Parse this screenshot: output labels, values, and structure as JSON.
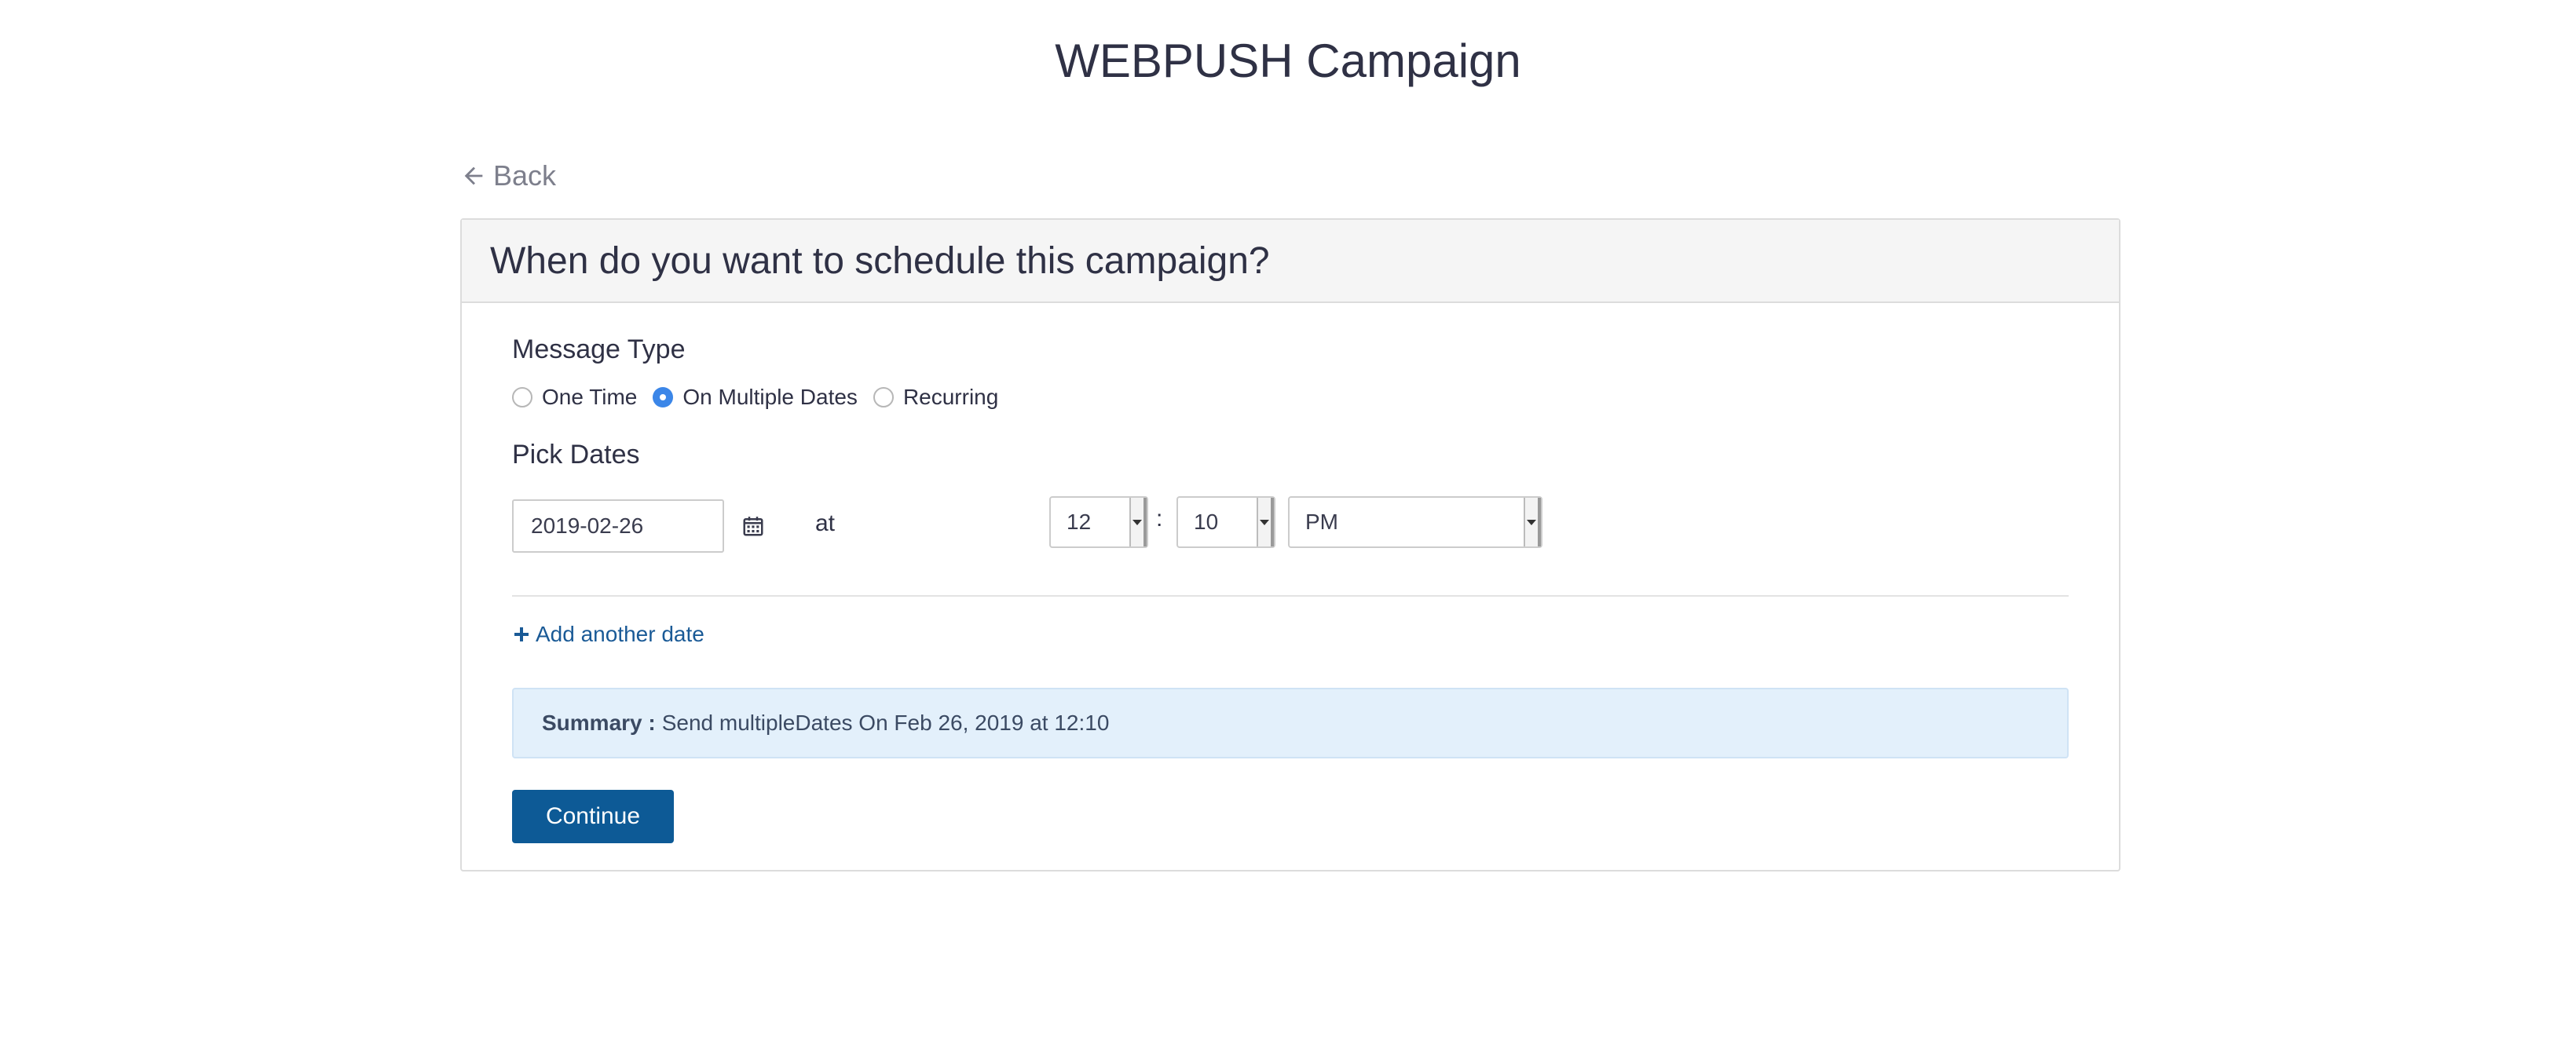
{
  "page": {
    "title": "WEBPUSH Campaign"
  },
  "nav": {
    "back_label": "Back",
    "back_icon": "arrow-left-icon"
  },
  "card": {
    "title": "When do you want to schedule this campaign?"
  },
  "message_type": {
    "label": "Message Type",
    "options": [
      {
        "label": "One Time",
        "checked": false
      },
      {
        "label": "On Multiple Dates",
        "checked": true
      },
      {
        "label": "Recurring",
        "checked": false
      }
    ]
  },
  "pick_dates": {
    "label": "Pick Dates",
    "date_value": "2019-02-26",
    "calendar_icon": "calendar-icon",
    "at_label": "at",
    "hour": "12",
    "separator": ":",
    "minute": "10",
    "meridiem": "PM"
  },
  "add_date": {
    "label": "Add another date",
    "icon": "plus-icon"
  },
  "summary": {
    "label": "Summary :",
    "text": "Send multipleDates On Feb 26, 2019 at 12:10"
  },
  "actions": {
    "continue_label": "Continue"
  },
  "colors": {
    "accent": "#0d5a96",
    "radio_checked": "#3b86e8",
    "summary_bg": "#e3f0fb",
    "link": "#1a5a96"
  }
}
